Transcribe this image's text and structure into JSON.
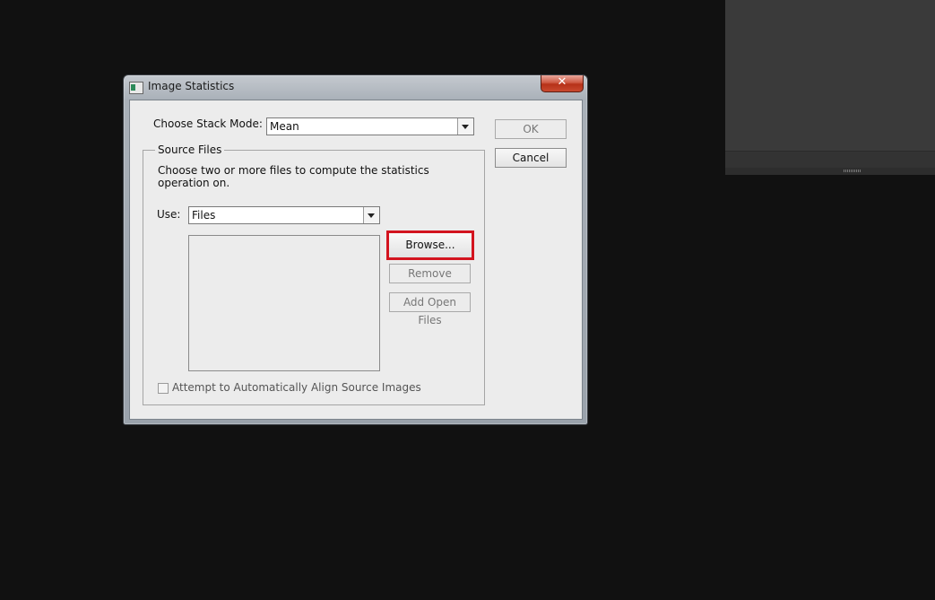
{
  "window": {
    "title": "Image Statistics",
    "close_glyph": "✕"
  },
  "stack_mode": {
    "label": "Choose Stack Mode:",
    "selected": "Mean"
  },
  "buttons": {
    "ok": "OK",
    "cancel": "Cancel",
    "browse": "Browse...",
    "remove": "Remove",
    "add_open_files": "Add Open Files"
  },
  "source_files": {
    "title": "Source Files",
    "description_line1": "Choose two or more files to compute the statistics",
    "description_line2": "operation on.",
    "use_label": "Use:",
    "use_selected": "Files",
    "file_list": []
  },
  "align": {
    "label": "Attempt to Automatically Align Source Images",
    "checked": false,
    "enabled": false
  },
  "colors": {
    "focus_ring": "#d3141f",
    "close_button": "#c94a30",
    "background": "#111111"
  }
}
